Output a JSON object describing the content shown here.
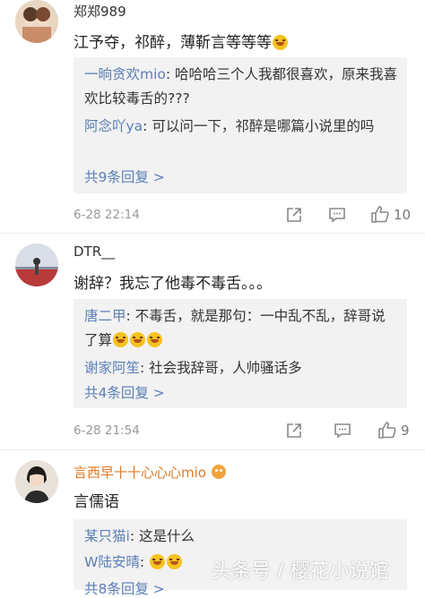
{
  "comments": [
    {
      "username": "郑郑989",
      "text": "江予夺，祁醉，薄靳言等等等",
      "replies": [
        {
          "name": "一晌贪欢mio",
          "text": ": 哈哈哈三个人我都很喜欢，原来我喜欢比较毒舌的???"
        },
        {
          "name": "阿念吖ya",
          "text": ": 可以问一下，祁醉是哪篇小说里的吗"
        }
      ],
      "more_replies": "共9条回复 >",
      "time": "6-28 22:14",
      "likes": "10"
    },
    {
      "username": "DTR__",
      "text": "谢辞？我忘了他毒不毒舌。。。",
      "replies": [
        {
          "name": "唐二甲",
          "text": ": 不毒舌，就是那句：一中乱不乱，辞哥说了算"
        },
        {
          "name": "谢家阿笙",
          "text": ": 社会我辞哥，人帅骚话多"
        }
      ],
      "more_replies": "共4条回复 >",
      "time": "6-28 21:54",
      "likes": "9"
    },
    {
      "username": "言西早十十心心心mio",
      "text": "言儒语",
      "replies": [
        {
          "name": "某只猫i",
          "text": ": 这是什么"
        },
        {
          "name": "W陆安晴",
          "text": ":"
        }
      ],
      "more_replies": "共8条回复 >"
    }
  ],
  "watermark": "头条号 / 樱花小说馆",
  "colors": {
    "link": "#5b7fb5",
    "vip_name": "#e07a25",
    "reply_bg": "#f2f2f2"
  }
}
